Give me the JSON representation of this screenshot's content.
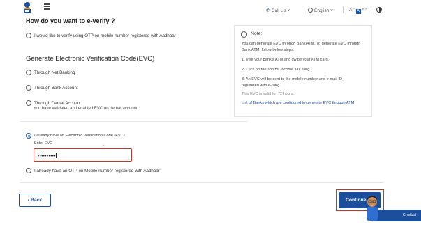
{
  "header": {
    "call_us": "Call Us",
    "language": "English",
    "font_size": "A⁻ A A⁺",
    "icons": [
      "emblem-logo",
      "menu-icon",
      "phone-icon",
      "globe-icon",
      "contrast-icon"
    ]
  },
  "main": {
    "question": "How do you want to e-verify ?",
    "option_aadhaar": "I would like to verify using OTP on mobile number registered with Aadhaar",
    "evc_heading": "Generate Electronic Verification Code(EVC)",
    "option_net_banking": "Through Net Banking",
    "option_bank_account": "Through Bank Account",
    "option_demat": "Through Demat Account",
    "demat_note": "You have validated and enabled EVC on demat account",
    "option_have_evc": "I already have an Electronic Verification Code (EVC)",
    "enter_evc_label": "Enter EVC",
    "evc_value": "••••••••••",
    "option_have_otp": "I already have an OTP on Mobile number registered with Aadhaar",
    "selected_option": "option_have_evc"
  },
  "note": {
    "title": "Note:",
    "intro": "You can generate EVC through Bank ATM. To generate EVC through Bank ATM, follow below steps:",
    "step1": "1. Visit your bank's ATM and swipe your ATM card.",
    "step2": "2. Click on the 'Pin for Income Tax filing'.",
    "step3": "3. An EVC will be sent to the mobile number and e-mail ID registered with e-filing.",
    "validity": "This EVC is valid for 72 hours.",
    "link": "List of Banks which are configured to generate EVC through ATM"
  },
  "footer": {
    "back_label": "‹ Back",
    "continue_label": "Continue",
    "chatbot_label": "Chatbot"
  },
  "colors": {
    "primary": "#1b4f9b",
    "highlight_red": "#c0392b"
  }
}
